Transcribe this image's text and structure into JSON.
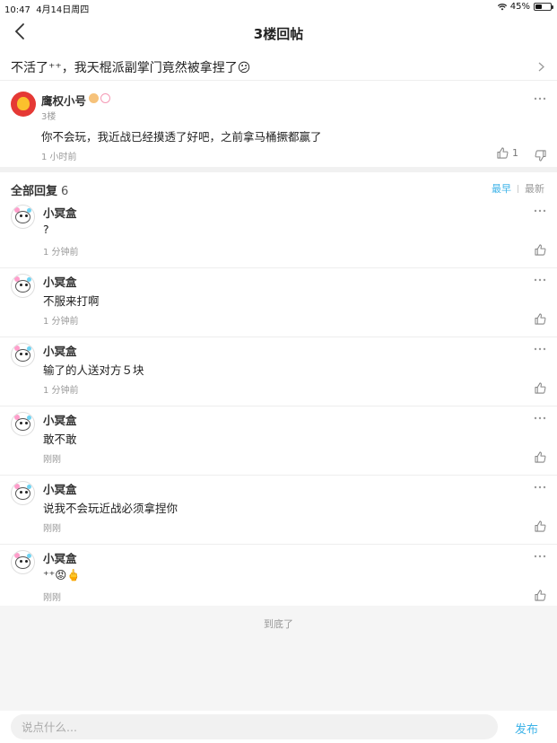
{
  "status_bar": {
    "time": "10:47",
    "date": "4月14日周四",
    "battery": "45%",
    "battery_level": 0.45
  },
  "nav": {
    "title": "3楼回帖",
    "back_icon": "chevron-left-icon"
  },
  "thread": {
    "title": "不活了⁺⁺，我天棍派副掌门竟然被拿捏了😕"
  },
  "floor": {
    "author": "鹰权小号",
    "floor_label": "3楼",
    "content": "你不会玩，我近战已经摸透了好吧，之前拿马桶撅都赢了",
    "time": "1 小时前",
    "like_count": "1"
  },
  "replies": {
    "label": "全部回复",
    "count": "6",
    "sort_earliest": "最早",
    "sort_latest": "最新",
    "items": [
      {
        "name": "小冥盒",
        "text": "?",
        "time": "1 分钟前"
      },
      {
        "name": "小冥盒",
        "text": "不服来打啊",
        "time": "1 分钟前"
      },
      {
        "name": "小冥盒",
        "text": "输了的人送对方５块",
        "time": "1 分钟前"
      },
      {
        "name": "小冥盒",
        "text": "敢不敢",
        "time": "刚刚"
      },
      {
        "name": "小冥盒",
        "text": "说我不会玩近战必须拿捏你",
        "time": "刚刚"
      },
      {
        "name": "小冥盒",
        "text": "⁺⁺😡🖕",
        "time": "刚刚"
      }
    ]
  },
  "end_text": "到底了",
  "composer": {
    "placeholder": "说点什么...",
    "send_label": "发布"
  },
  "colors": {
    "accent": "#3db3e8",
    "muted": "#999999",
    "separator": "#f1f1f1"
  }
}
